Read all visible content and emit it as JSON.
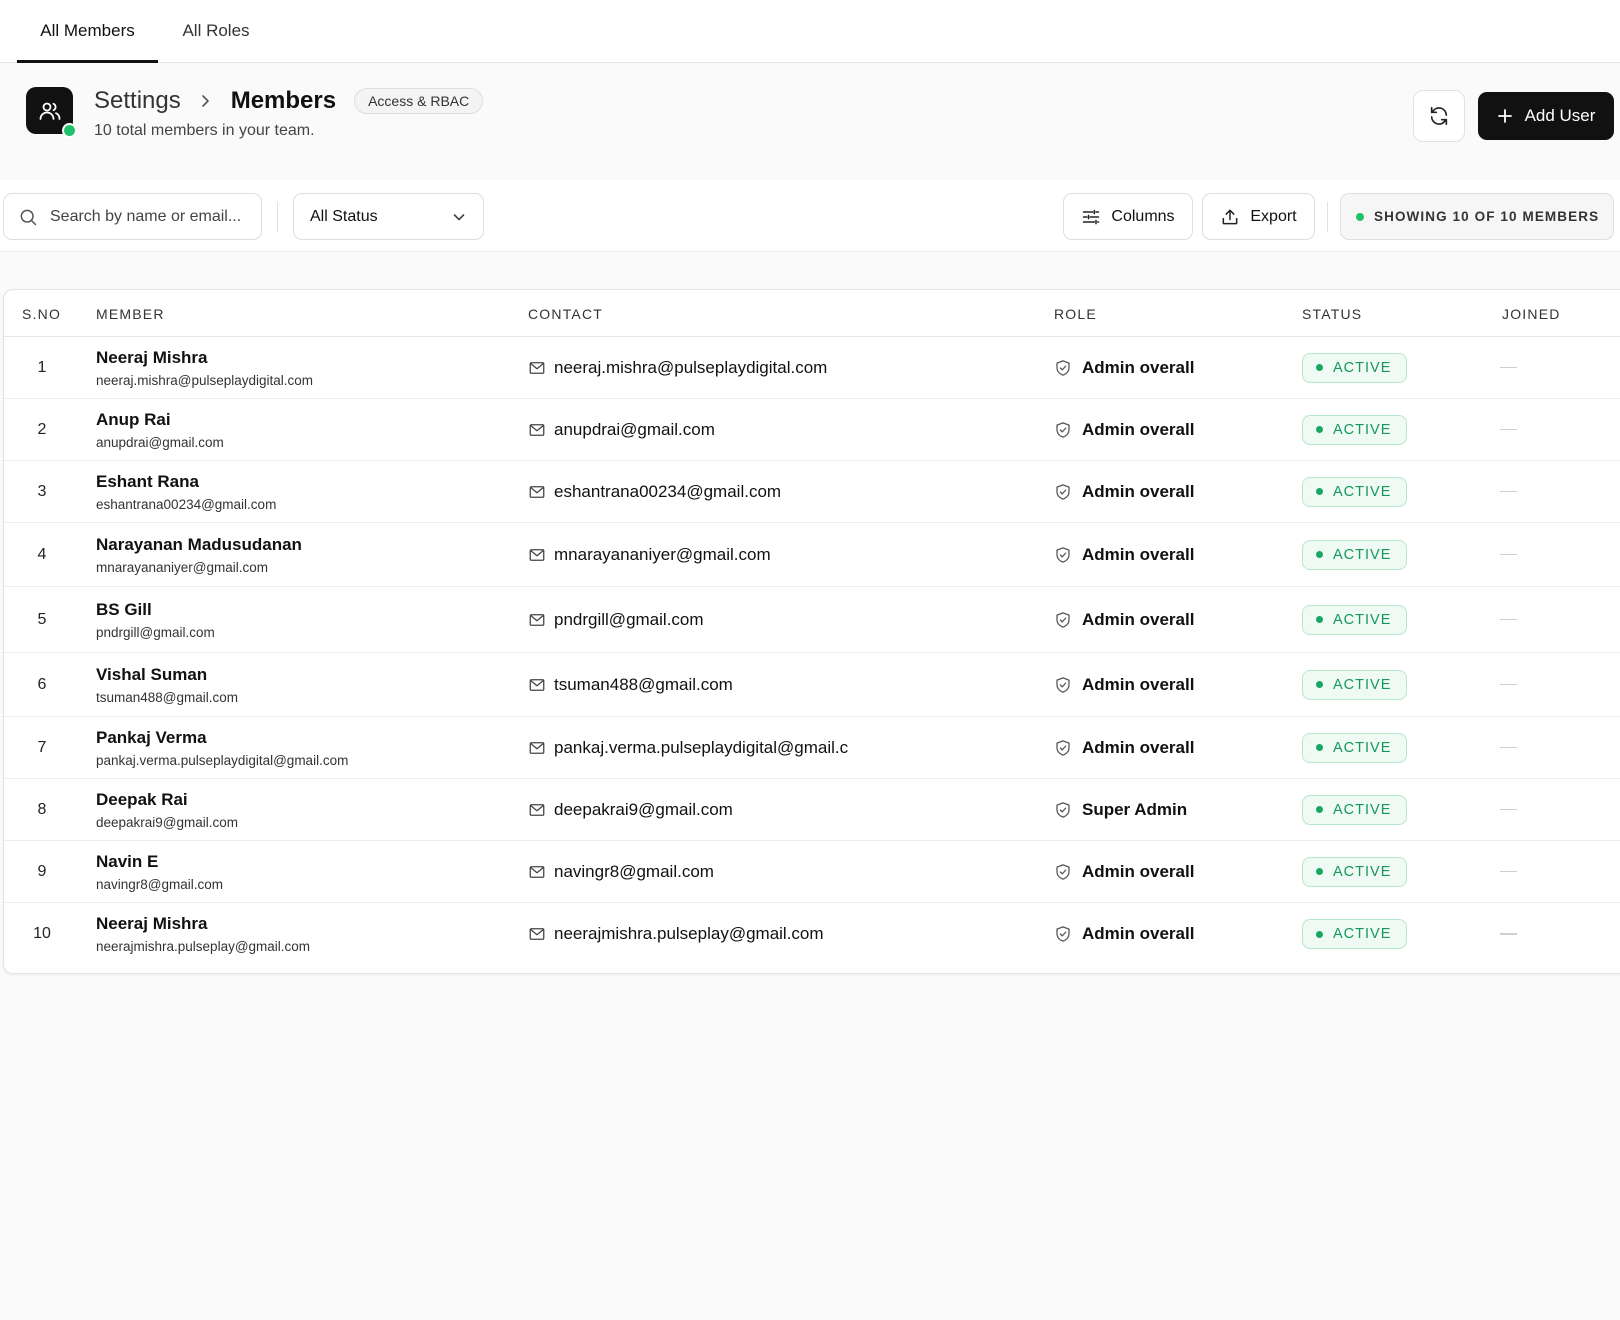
{
  "tabs": [
    {
      "label": "All Members",
      "active": true
    },
    {
      "label": "All Roles",
      "active": false
    }
  ],
  "header": {
    "breadcrumb_parent": "Settings",
    "breadcrumb_current": "Members",
    "badge": "Access & RBAC",
    "subtitle": "10 total members in your team.",
    "add_user_label": "Add User"
  },
  "toolbar": {
    "search_placeholder": "Search by name or email...",
    "status_filter": "All Status",
    "columns_label": "Columns",
    "export_label": "Export",
    "showing_label": "SHOWING 10 OF 10 MEMBERS"
  },
  "table": {
    "columns": [
      "S.NO",
      "MEMBER",
      "CONTACT",
      "ROLE",
      "STATUS",
      "JOINED"
    ],
    "rows": [
      {
        "sno": "1",
        "name": "Neeraj Mishra",
        "email": "neeraj.mishra@pulseplaydigital.com",
        "contact": "neeraj.mishra@pulseplaydigital.com",
        "role": "Admin overall",
        "status": "ACTIVE"
      },
      {
        "sno": "2",
        "name": "Anup Rai",
        "email": "anupdrai@gmail.com",
        "contact": "anupdrai@gmail.com",
        "role": "Admin overall",
        "status": "ACTIVE"
      },
      {
        "sno": "3",
        "name": "Eshant Rana",
        "email": "eshantrana00234@gmail.com",
        "contact": "eshantrana00234@gmail.com",
        "role": "Admin overall",
        "status": "ACTIVE"
      },
      {
        "sno": "4",
        "name": "Narayanan Madusudanan",
        "email": "mnarayananiyer@gmail.com",
        "contact": "mnarayananiyer@gmail.com",
        "role": "Admin overall",
        "status": "ACTIVE"
      },
      {
        "sno": "5",
        "name": "BS Gill",
        "email": "pndrgill@gmail.com",
        "contact": "pndrgill@gmail.com",
        "role": "Admin overall",
        "status": "ACTIVE"
      },
      {
        "sno": "6",
        "name": "Vishal Suman",
        "email": "tsuman488@gmail.com",
        "contact": "tsuman488@gmail.com",
        "role": "Admin overall",
        "status": "ACTIVE"
      },
      {
        "sno": "7",
        "name": "Pankaj Verma",
        "email": "pankaj.verma.pulseplaydigital@gmail.com",
        "contact": "pankaj.verma.pulseplaydigital@gmail.com",
        "role": "Admin overall",
        "status": "ACTIVE"
      },
      {
        "sno": "8",
        "name": "Deepak Rai",
        "email": "deepakrai9@gmail.com",
        "contact": "deepakrai9@gmail.com",
        "role": "Super Admin",
        "status": "ACTIVE"
      },
      {
        "sno": "9",
        "name": "Navin E",
        "email": "navingr8@gmail.com",
        "contact": "navingr8@gmail.com",
        "role": "Admin overall",
        "status": "ACTIVE"
      },
      {
        "sno": "10",
        "name": "Neeraj Mishra",
        "email": "neerajmishra.pulseplay@gmail.com",
        "contact": "neerajmishra.pulseplay@gmail.com",
        "role": "Admin overall",
        "status": "ACTIVE"
      }
    ]
  },
  "icons": {
    "app": "users-icon",
    "breadcrumb_separator": "chevron-right-icon",
    "refresh": "refresh-icon",
    "add": "plus-icon",
    "search": "search-icon",
    "dropdown": "chevron-down-icon",
    "columns": "sliders-icon",
    "export": "upload-icon",
    "contact": "mail-icon",
    "role": "shield-check-icon"
  },
  "colors": {
    "primary": "#111111",
    "success": "#16985a",
    "online": "#21c16b"
  }
}
